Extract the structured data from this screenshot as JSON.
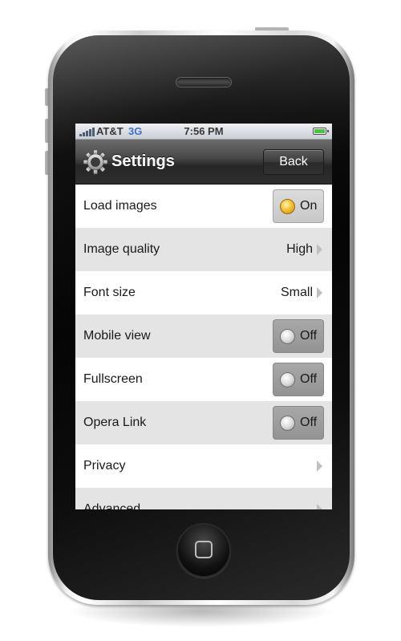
{
  "status_bar": {
    "carrier": "AT&T",
    "network": "3G",
    "time": "7:56 PM",
    "signal_icon": "signal-bars-icon",
    "battery_icon": "battery-icon",
    "battery_color": "#46c13e"
  },
  "nav_bar": {
    "icon": "gear-icon",
    "title": "Settings",
    "back_label": "Back"
  },
  "settings": [
    {
      "label": "Load images",
      "control": "toggle",
      "value": "On",
      "state": true
    },
    {
      "label": "Image quality",
      "control": "disclosure",
      "value": "High"
    },
    {
      "label": "Font size",
      "control": "disclosure",
      "value": "Small"
    },
    {
      "label": "Mobile view",
      "control": "toggle",
      "value": "Off",
      "state": false
    },
    {
      "label": "Fullscreen",
      "control": "toggle",
      "value": "Off",
      "state": false
    },
    {
      "label": "Opera Link",
      "control": "toggle",
      "value": "Off",
      "state": false
    },
    {
      "label": "Privacy",
      "control": "disclosure",
      "value": ""
    },
    {
      "label": "Advanced",
      "control": "disclosure",
      "value": ""
    }
  ],
  "colors": {
    "toggle_on_knob": "#f2c23a",
    "row_alt": "#e4e4e4",
    "nav_dark": "#262626"
  }
}
